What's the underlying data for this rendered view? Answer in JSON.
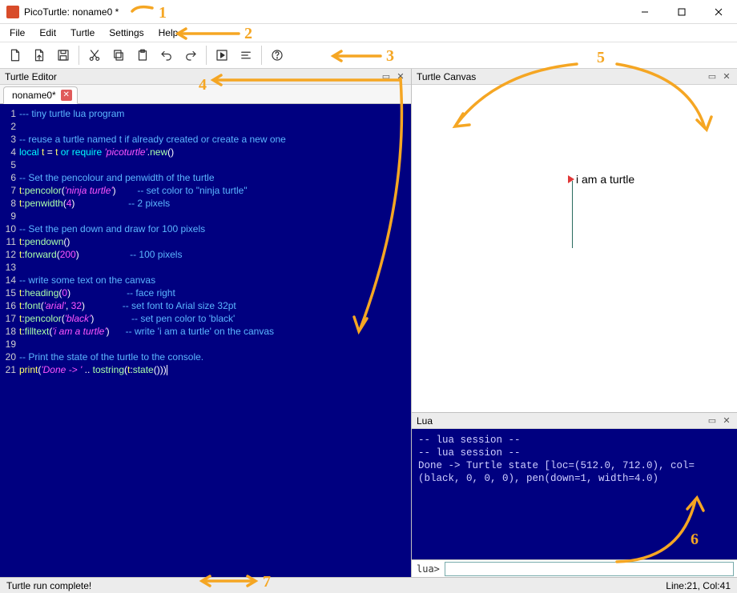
{
  "window_title": "PicoTurtle: noname0 *",
  "menu": [
    "File",
    "Edit",
    "Turtle",
    "Settings",
    "Help"
  ],
  "panes": {
    "editor_title": "Turtle Editor",
    "canvas_title": "Turtle Canvas",
    "lua_title": "Lua"
  },
  "tabs": [
    {
      "label": "noname0*"
    }
  ],
  "canvas_text": "i am a turtle",
  "code_lines": [
    {
      "n": 1,
      "html": "<span class='c-comment'>--- tiny turtle lua program</span>"
    },
    {
      "n": 2,
      "html": ""
    },
    {
      "n": 3,
      "html": "<span class='c-comment'>-- reuse a turtle named t if already created or create a new one</span>"
    },
    {
      "n": 4,
      "html": "<span class='c-kw'>local</span> <span class='c-id'>t</span> <span class='c-op'>=</span> <span class='c-id'>t</span> <span class='c-kw'>or</span> <span class='c-kw'>require</span> <span class='c-str'>'picoturtle'</span><span class='c-op'>.</span><span class='c-fn'>new</span><span class='c-op'>()</span>"
    },
    {
      "n": 5,
      "html": ""
    },
    {
      "n": 6,
      "html": "<span class='c-comment'>-- Set the pencolour and penwidth of the turtle</span>"
    },
    {
      "n": 7,
      "html": "<span class='c-id'>t</span><span class='c-op'>:</span><span class='c-fn'>pencolor</span><span class='c-op'>(</span><span class='c-str'>'ninja turtle'</span><span class='c-op'>)</span>        <span class='c-comment'>-- set color to \"ninja turtle\"</span>"
    },
    {
      "n": 8,
      "html": "<span class='c-id'>t</span><span class='c-op'>:</span><span class='c-fn'>penwidth</span><span class='c-op'>(</span><span class='c-num'>4</span><span class='c-op'>)</span>                    <span class='c-comment'>-- 2 pixels</span>"
    },
    {
      "n": 9,
      "html": ""
    },
    {
      "n": 10,
      "html": "<span class='c-comment'>-- Set the pen down and draw for 100 pixels</span>"
    },
    {
      "n": 11,
      "html": "<span class='c-id'>t</span><span class='c-op'>:</span><span class='c-fn'>pendown</span><span class='c-op'>()</span>"
    },
    {
      "n": 12,
      "html": "<span class='c-id'>t</span><span class='c-op'>:</span><span class='c-fn'>forward</span><span class='c-op'>(</span><span class='c-num'>200</span><span class='c-op'>)</span>                   <span class='c-comment'>-- 100 pixels</span>"
    },
    {
      "n": 13,
      "html": ""
    },
    {
      "n": 14,
      "html": "<span class='c-comment'>-- write some text on the canvas</span>"
    },
    {
      "n": 15,
      "html": "<span class='c-id'>t</span><span class='c-op'>:</span><span class='c-fn'>heading</span><span class='c-op'>(</span><span class='c-num'>0</span><span class='c-op'>)</span>                     <span class='c-comment'>-- face right</span>"
    },
    {
      "n": 16,
      "html": "<span class='c-id'>t</span><span class='c-op'>:</span><span class='c-fn'>font</span><span class='c-op'>(</span><span class='c-str'>'arial'</span><span class='c-op'>,</span> <span class='c-num'>32</span><span class='c-op'>)</span>              <span class='c-comment'>-- set font to Arial size 32pt</span>"
    },
    {
      "n": 17,
      "html": "<span class='c-id'>t</span><span class='c-op'>:</span><span class='c-fn'>pencolor</span><span class='c-op'>(</span><span class='c-str'>'black'</span><span class='c-op'>)</span>              <span class='c-comment'>-- set pen color to 'black'</span>"
    },
    {
      "n": 18,
      "html": "<span class='c-id'>t</span><span class='c-op'>:</span><span class='c-fn'>filltext</span><span class='c-op'>(</span><span class='c-str'>'i am a turtle'</span><span class='c-op'>)</span>      <span class='c-comment'>-- write 'i am a turtle' on the canvas</span>"
    },
    {
      "n": 19,
      "html": ""
    },
    {
      "n": 20,
      "html": "<span class='c-comment'>-- Print the state of the turtle to the console.</span>"
    },
    {
      "n": 21,
      "html": "<span class='c-print'>print</span><span class='c-op'>(</span><span class='c-str'>'Done -> '</span> <span class='c-op'>..</span> <span class='c-fn'>tostring</span><span class='c-op'>(</span><span class='c-id'>t</span><span class='c-op'>:</span><span class='c-fn'>state</span><span class='c-op'>()))</span><span class='cursor'></span>"
    }
  ],
  "lua_output": "-- lua session --\n-- lua session --\nDone -> Turtle state [loc=(512.0, 712.0), col=(black, 0, 0, 0), pen(down=1, width=4.0)",
  "lua_prompt": "lua>",
  "status_left": "Turtle run complete!",
  "status_right": "Line:21, Col:41",
  "annotations": [
    "1",
    "2",
    "3",
    "4",
    "5",
    "6",
    "7"
  ]
}
